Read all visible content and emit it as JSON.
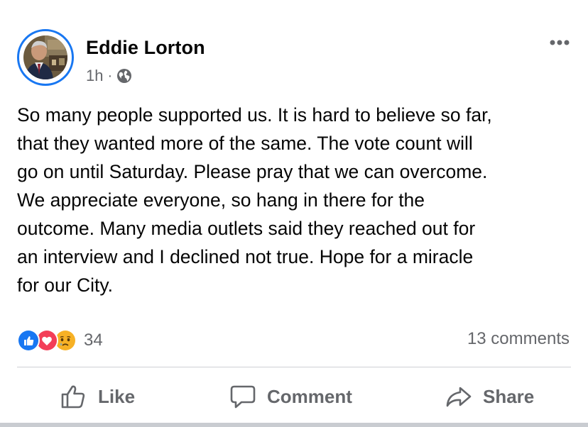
{
  "post": {
    "author": "Eddie Lorton",
    "time": "1h",
    "separator": "·",
    "privacy_icon": "globe-icon",
    "more_icon": "more-icon",
    "text_lines": [
      "So many people supported us. It is hard to believe so far,",
      "that they wanted more of the same. The vote count will",
      "go on until Saturday. Please pray that we can overcome.",
      "We appreciate everyone, so hang in there for the",
      "outcome. Many media outlets said they reached out for",
      "an interview and I declined not true. Hope for a miracle",
      "for our City."
    ]
  },
  "reactions": {
    "icons": [
      "like-reaction-icon",
      "love-reaction-icon",
      "sad-reaction-icon"
    ],
    "count": "34",
    "comments": "13 comments"
  },
  "actions": {
    "like_label": "Like",
    "comment_label": "Comment",
    "share_label": "Share"
  },
  "colors": {
    "accent": "#1877f2",
    "love": "#f33e58",
    "sad": "#f7b125",
    "muted_text": "#65676b",
    "divider": "#ced0d4"
  }
}
